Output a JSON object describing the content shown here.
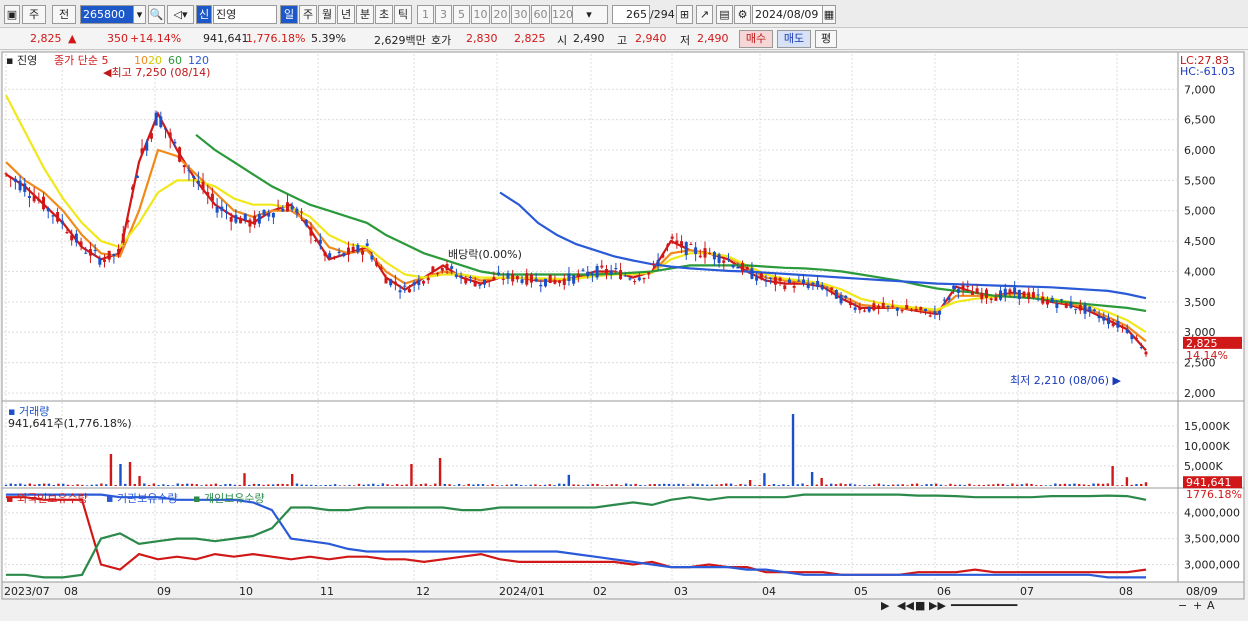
{
  "toolbar": {
    "mode_ju": "주",
    "mode_jeon": "전",
    "stock_code": "265800",
    "badge_new": "신",
    "stock_name": "진영",
    "periods": [
      "일",
      "주",
      "월",
      "년",
      "분",
      "초",
      "틱"
    ],
    "intervals": [
      "1",
      "3",
      "5",
      "10",
      "20",
      "30",
      "60",
      "120"
    ],
    "count": "265",
    "total": "/294",
    "date": "2024/08/09"
  },
  "quote": {
    "price": "2,825",
    "arrow": "▲",
    "change": "350",
    "pct": "+14.14%",
    "volume": "941,641",
    "vol_pct": "1,776.18%",
    "turnover": "5.39%",
    "amount": "2,629백만",
    "bid_label": "호가",
    "ask": "2,830",
    "bid": "2,825",
    "open_label": "시",
    "open": "2,490",
    "high_label": "고",
    "high": "2,940",
    "low_label": "저",
    "low": "2,490",
    "buy": "매수",
    "sell": "매도",
    "eval": "평"
  },
  "chart_data": [
    {
      "type": "candlestick",
      "legend": [
        "진영",
        "종가 단순",
        "5",
        "10",
        "20",
        "60",
        "120"
      ],
      "max_note": "최고 7,250 (08/14)",
      "min_note": "최저 2,210 (08/06)",
      "event_note": "배당락(0.00%)",
      "lc": "LC:27.83",
      "hc": "HC:-61.03",
      "y_ticks": [
        "7,000",
        "6,500",
        "6,000",
        "5,500",
        "5,000",
        "4,500",
        "4,000",
        "3,500",
        "3,000",
        "2,500",
        "2,000"
      ],
      "ylim": [
        1950,
        7350
      ],
      "current_price": "2,825",
      "current_pct": "14.14%",
      "series": [
        {
          "name": "5",
          "values": [
            5600,
            5400,
            5100,
            4800,
            4400,
            4200,
            4300,
            5800,
            6600,
            6000,
            5500,
            5100,
            4900,
            4800,
            5000,
            5100,
            4700,
            4200,
            4300,
            4400,
            3900,
            3700,
            3900,
            4100,
            3900,
            3800,
            3900,
            3900,
            3850,
            3850,
            3900,
            4000,
            4000,
            3900,
            4000,
            4500,
            4350,
            4300,
            4200,
            4000,
            3850,
            3800,
            3800,
            3750,
            3550,
            3400,
            3400,
            3400,
            3350,
            3300,
            3750,
            3650,
            3600,
            3650,
            3600,
            3500,
            3450,
            3350,
            3200,
            3050,
            2700
          ]
        },
        {
          "name": "10",
          "values": [
            5800,
            5500,
            5300,
            5000,
            4600,
            4300,
            4250,
            5000,
            6000,
            5900,
            5600,
            5300,
            5000,
            4900,
            5000,
            5000,
            4800,
            4400,
            4300,
            4350,
            4000,
            3800,
            3900,
            4000,
            3950,
            3850,
            3900,
            3900,
            3870,
            3860,
            3880,
            3950,
            3980,
            3950,
            3980,
            4300,
            4350,
            4300,
            4250,
            4050,
            3900,
            3850,
            3820,
            3780,
            3600,
            3450,
            3420,
            3400,
            3370,
            3330,
            3600,
            3600,
            3600,
            3620,
            3600,
            3520,
            3470,
            3380,
            3250,
            3100,
            2850
          ]
        },
        {
          "name": "20",
          "values": [
            6900,
            6300,
            5700,
            5200,
            4800,
            4500,
            4400,
            4800,
            5300,
            5500,
            5500,
            5400,
            5200,
            5100,
            5100,
            5050,
            4900,
            4600,
            4450,
            4400,
            4150,
            3950,
            3900,
            3950,
            3950,
            3900,
            3900,
            3900,
            3890,
            3880,
            3880,
            3920,
            3950,
            3960,
            3980,
            4200,
            4300,
            4300,
            4250,
            4100,
            3950,
            3880,
            3850,
            3800,
            3700,
            3550,
            3480,
            3430,
            3400,
            3370,
            3500,
            3550,
            3580,
            3600,
            3600,
            3550,
            3500,
            3430,
            3330,
            3200,
            3000
          ]
        },
        {
          "name": "60",
          "values": [
            null,
            null,
            null,
            null,
            null,
            null,
            null,
            null,
            null,
            null,
            6250,
            6000,
            5800,
            5600,
            5400,
            5250,
            5100,
            5000,
            4900,
            4800,
            4600,
            4450,
            4300,
            4200,
            4100,
            4000,
            3950,
            3950,
            3950,
            3950,
            3950,
            3950,
            3960,
            3980,
            4000,
            4050,
            4100,
            4100,
            4100,
            4100,
            4080,
            4060,
            4050,
            4030,
            4000,
            3950,
            3900,
            3850,
            3780,
            3720,
            3680,
            3650,
            3600,
            3580,
            3560,
            3520,
            3490,
            3460,
            3430,
            3400,
            3350
          ]
        },
        {
          "name": "120",
          "values": [
            null,
            null,
            null,
            null,
            null,
            null,
            null,
            null,
            null,
            null,
            null,
            null,
            null,
            null,
            null,
            null,
            null,
            null,
            null,
            null,
            null,
            null,
            null,
            null,
            null,
            null,
            5300,
            5100,
            4800,
            4600,
            4450,
            4350,
            4250,
            4180,
            4120,
            4080,
            4050,
            4030,
            4010,
            4000,
            3980,
            3960,
            3940,
            3920,
            3900,
            3880,
            3860,
            3840,
            3820,
            3800,
            3790,
            3780,
            3770,
            3760,
            3750,
            3740,
            3720,
            3700,
            3680,
            3630,
            3560
          ]
        }
      ]
    },
    {
      "type": "bar",
      "title": "거래량",
      "sub": "941,641주(1,776.18%)",
      "y_ticks": [
        "15,000K",
        "10,000K",
        "5,000K"
      ],
      "current": "941,641",
      "current_pct": "1776.18%",
      "ylim": [
        0,
        20000
      ],
      "values": [
        0,
        0,
        0,
        0,
        0,
        0,
        0,
        0,
        0,
        0,
        0,
        0,
        0,
        0,
        0,
        0,
        0,
        0,
        0,
        0,
        0,
        0,
        0,
        0,
        0,
        0,
        0,
        0,
        0,
        0,
        0,
        0,
        0,
        0,
        0,
        0,
        0,
        0,
        0,
        0,
        0,
        0,
        0,
        0,
        0,
        0,
        0,
        0,
        0,
        0,
        0,
        0,
        0,
        0,
        0,
        0,
        0,
        0,
        0,
        0,
        941
      ]
    },
    {
      "type": "line",
      "legend": [
        "외국인보유수량",
        "기관보유수량",
        "개인보유수량"
      ],
      "y_ticks": [
        "4,000,000",
        "3,500,000",
        "3,000,000"
      ],
      "ylim": [
        2700000,
        4400000
      ],
      "series": [
        {
          "name": "외국인보유수량",
          "color": "#d01818",
          "values": [
            4300000,
            4300000,
            4250000,
            4250000,
            4250000,
            3000000,
            2900000,
            3200000,
            3100000,
            3150000,
            3100000,
            3200000,
            3150000,
            3200000,
            3150000,
            3100000,
            3150000,
            3100000,
            3150000,
            3150000,
            3100000,
            3100000,
            3050000,
            3100000,
            3150000,
            3200000,
            3100000,
            3050000,
            3050000,
            3050000,
            3050000,
            3050000,
            3050000,
            3000000,
            3050000,
            2950000,
            2950000,
            3000000,
            2950000,
            2950000,
            2850000,
            2850000,
            2850000,
            2850000,
            2800000,
            2800000,
            2800000,
            2800000,
            2850000,
            2850000,
            2850000,
            2900000,
            2850000,
            2850000,
            2850000,
            2850000,
            2850000,
            2850000,
            2850000,
            2850000,
            2900000
          ]
        },
        {
          "name": "기관보유수량",
          "color": "#2a5ad8",
          "values": [
            4350000,
            4350000,
            4350000,
            4350000,
            4350000,
            4350000,
            4300000,
            4300000,
            4300000,
            4250000,
            4250000,
            4250000,
            4250000,
            4200000,
            4050000,
            3500000,
            3450000,
            3400000,
            3300000,
            3250000,
            3250000,
            3250000,
            3250000,
            3250000,
            3250000,
            3250000,
            3250000,
            3250000,
            3250000,
            3250000,
            3200000,
            3150000,
            3100000,
            3050000,
            3000000,
            2950000,
            2950000,
            2950000,
            2950000,
            2900000,
            2900000,
            2850000,
            2800000,
            2800000,
            2800000,
            2800000,
            2800000,
            2800000,
            2800000,
            2800000,
            2800000,
            2800000,
            2800000,
            2800000,
            2800000,
            2800000,
            2800000,
            2800000,
            2750000,
            2750000,
            2750000
          ]
        },
        {
          "name": "개인보유수량",
          "color": "#2b8a4a",
          "values": [
            2800000,
            2800000,
            2750000,
            2750000,
            2800000,
            3500000,
            3600000,
            3400000,
            3450000,
            3500000,
            3500000,
            3450000,
            3500000,
            3550000,
            3700000,
            4100000,
            4100000,
            4050000,
            4050000,
            4100000,
            4100000,
            4100000,
            4100000,
            4100000,
            4050000,
            4050000,
            4100000,
            4100000,
            4100000,
            4100000,
            4100000,
            4100000,
            4150000,
            4200000,
            4150000,
            4250000,
            4300000,
            4250000,
            4300000,
            4300000,
            4300000,
            4300000,
            4350000,
            4350000,
            4350000,
            4350000,
            4350000,
            4350000,
            4330000,
            4330000,
            4320000,
            4300000,
            4300000,
            4300000,
            4300000,
            4320000,
            4320000,
            4320000,
            4330000,
            4320000,
            4250000
          ]
        }
      ]
    }
  ],
  "x_axis": [
    "2023/07",
    "08",
    "09",
    "10",
    "11",
    "12",
    "2024/01",
    "02",
    "03",
    "04",
    "05",
    "06",
    "07",
    "08",
    "08/09"
  ],
  "colors": {
    "up": "#d01818",
    "down": "#1a50c8",
    "ma5": "#d01818",
    "ma10": "#f08a1a",
    "ma20": "#f0e81a",
    "ma60": "#2a9a3a",
    "ma120": "#2a5ad8"
  }
}
